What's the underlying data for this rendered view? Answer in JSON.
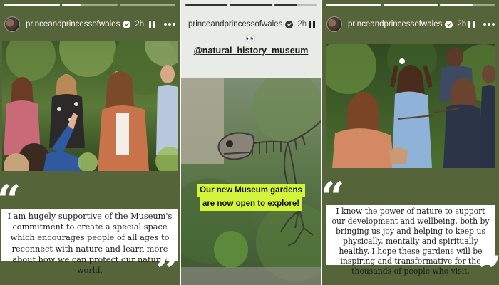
{
  "colors": {
    "panel_bg": "#56643a",
    "highlight": "#d2f53c",
    "white": "#ffffff"
  },
  "story1": {
    "username": "princeandprincessofwales",
    "time": "2h",
    "progress": [
      1.0,
      0.35,
      0.0
    ],
    "quote": "I am hugely supportive of the Museum's commitment to create a special space which encourages people of all ages to reconnect with nature and learn more about how we can protect our natural world.",
    "open_quote": "“",
    "close_quote": "”"
  },
  "story2": {
    "username": "princeandprincessofwales",
    "time": "2h",
    "progress": [
      1.0,
      1.0,
      0.55
    ],
    "eyes": "👀",
    "mention": "@natural_history_museum",
    "caption_line1": "Our new Museum gardens",
    "caption_line2": "are now open to explore!"
  },
  "story3": {
    "username": "princeandprincessofwales",
    "time": "2h",
    "progress": [
      1.0,
      1.0,
      0.6
    ],
    "quote": "I know the power of nature to support our development and wellbeing, both by bringing us joy and helping to keep us physically, mentally and spiritually healthy. I hope these gardens will be inspiring and transformative for the thousands of people who visit.",
    "open_quote": "“",
    "close_quote": "”"
  }
}
